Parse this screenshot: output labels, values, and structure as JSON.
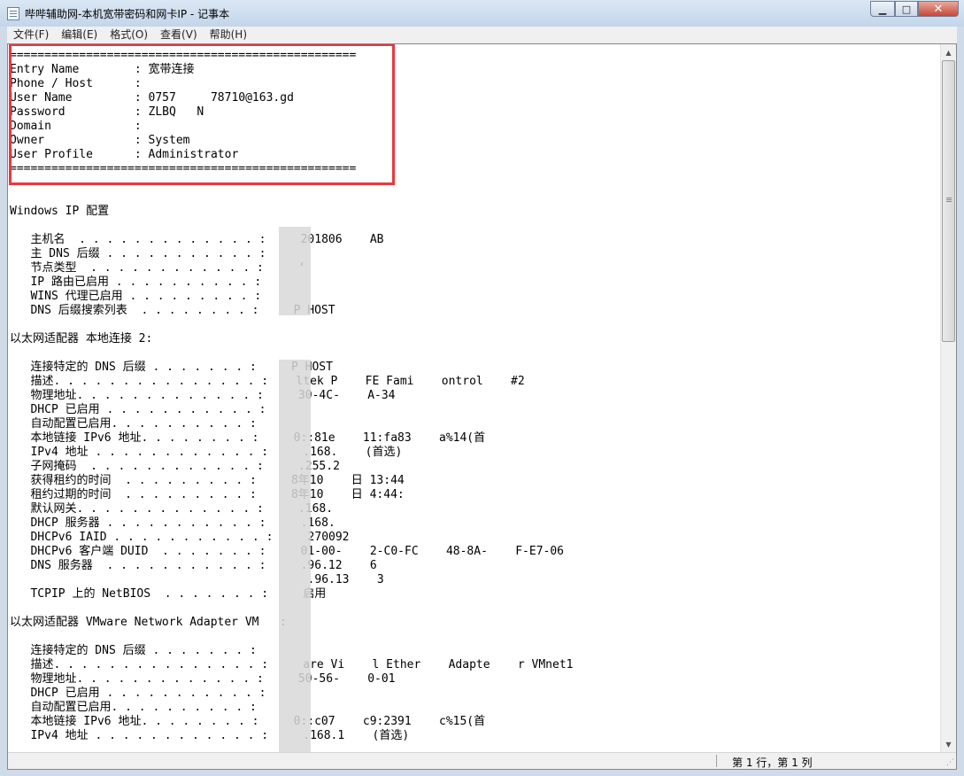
{
  "window": {
    "title": "哔哔辅助网-本机宽带密码和网卡IP - 记事本",
    "min_glyph": "▁",
    "max_glyph": "□",
    "close_glyph": "✕"
  },
  "menu": {
    "items": [
      "文件(F)",
      "编辑(E)",
      "格式(O)",
      "查看(V)",
      "帮助(H)"
    ]
  },
  "document": {
    "lines": [
      "==================================================",
      "Entry Name        : 宽带连接",
      "Phone / Host      :",
      "User Name         : 0757     78710@163.gd",
      "Password          : ZLBQ   N",
      "Domain            :",
      "Owner             : System",
      "User Profile      : Administrator",
      "==================================================",
      "",
      "",
      "Windows IP 配置",
      "",
      "   主机名  . . . . . . . . . . . . . :     201806    AB",
      "   主 DNS 后缀 . . . . . . . . . . . :",
      "   节点类型  . . . . . . . . . . . . :     ‘",
      "   IP 路由已启用 . . . . . . . . . . :",
      "   WINS 代理已启用 . . . . . . . . . :",
      "   DNS 后缀搜索列表  . . . . . . . . :     P HOST",
      "",
      "以太网适配器 本地连接 2:",
      "",
      "   连接特定的 DNS 后缀 . . . . . . . :     P HOST",
      "   描述. . . . . . . . . . . . . . . :    ltek P    FE Fami    ontrol    #2",
      "   物理地址. . . . . . . . . . . . . :     30-4C-    A-34",
      "   DHCP 已启用 . . . . . . . . . . . :",
      "   自动配置已启用. . . . . . . . . . :",
      "   本地链接 IPv6 地址. . . . . . . . :     0::81e    11:fa83    a%14(首",
      "   IPv4 地址 . . . . . . . . . . . . :     .168.    (首选)",
      "   子网掩码  . . . . . . . . . . . . :     .255.2",
      "   获得租约的时间  . . . . . . . . . :     8年10    日 13:44",
      "   租约过期的时间  . . . . . . . . . :     8年10    日 4:44:",
      "   默认网关. . . . . . . . . . . . . :     .168.",
      "   DHCP 服务器 . . . . . . . . . . . :     .168.",
      "   DHCPv6 IAID . . . . . . . . . . . :     270092",
      "   DHCPv6 客户端 DUID  . . . . . . . :     01-00-    2-C0-FC    48-8A-    F-E7-06",
      "   DNS 服务器  . . . . . . . . . . . :     .96.12    6",
      "                                           .96.13    3",
      "   TCPIP 上的 NetBIOS  . . . . . . . :     启用",
      "",
      "以太网适配器 VMware Network Adapter VM   :",
      "",
      "   连接特定的 DNS 后缀 . . . . . . . :",
      "   描述. . . . . . . . . . . . . . . :     are Vi    l Ether    Adapte    r VMnet1",
      "   物理地址. . . . . . . . . . . . . :     50-56-    0-01",
      "   DHCP 已启用 . . . . . . . . . . . :",
      "   自动配置已启用. . . . . . . . . . :",
      "   本地链接 IPv6 地址. . . . . . . . :     0::c07    c9:2391    c%15(首",
      "   IPv4 地址 . . . . . . . . . . . . :     .168.1    (首选)"
    ]
  },
  "status": {
    "position": "第 1 行，第 1 列"
  }
}
